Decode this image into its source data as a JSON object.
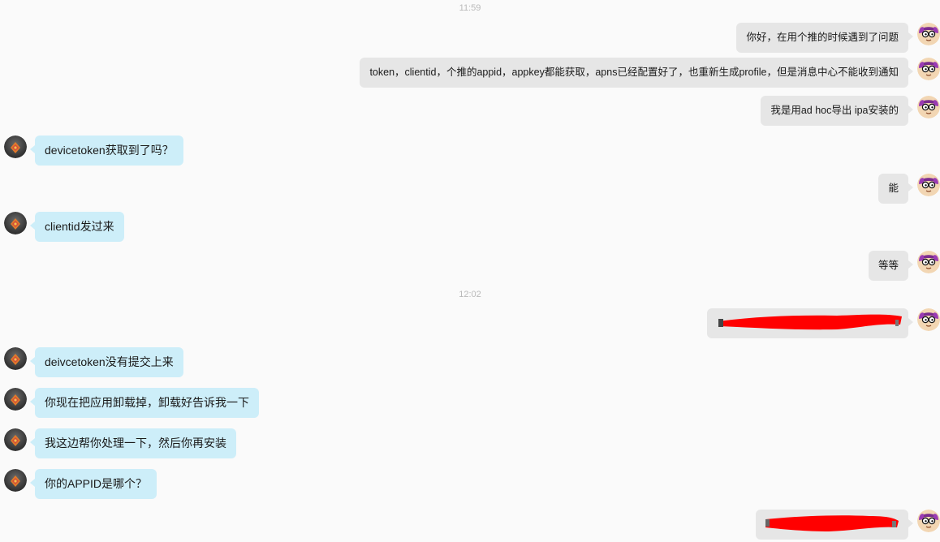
{
  "timestamps": [
    "11:59",
    "12:02"
  ],
  "messages": [
    {
      "side": "out",
      "text": "你好，在用个推的时候遇到了问题"
    },
    {
      "side": "out",
      "text": "token，clientid，个推的appid，appkey都能获取，apns已经配置好了，也重新生成profile，但是消息中心不能收到通知"
    },
    {
      "side": "out",
      "text": "我是用ad hoc导出 ipa安装的"
    },
    {
      "side": "in",
      "text": "devicetoken获取到了吗？"
    },
    {
      "side": "out",
      "text": "能"
    },
    {
      "side": "in",
      "text": "clientid发过来"
    },
    {
      "side": "out",
      "text": "等等"
    },
    {
      "side": "out",
      "text": "",
      "redacted": true
    },
    {
      "side": "in",
      "text": "deivcetoken没有提交上来"
    },
    {
      "side": "in",
      "text": "你现在把应用卸载掉，卸载好告诉我一下"
    },
    {
      "side": "in",
      "text": "我这边帮你处理一下，然后你再安装"
    },
    {
      "side": "in",
      "text": "你的APPID是哪个？"
    },
    {
      "side": "out",
      "text": "",
      "redacted": true
    }
  ],
  "colors": {
    "incoming_bubble": "#cdeef9",
    "outgoing_bubble": "#e6e6e6",
    "redaction": "#ff0000",
    "timestamp": "#b9b9b9"
  },
  "icons": {
    "incoming_avatar": "support-agent-avatar-icon",
    "outgoing_avatar": "user-cartoon-avatar-icon"
  }
}
